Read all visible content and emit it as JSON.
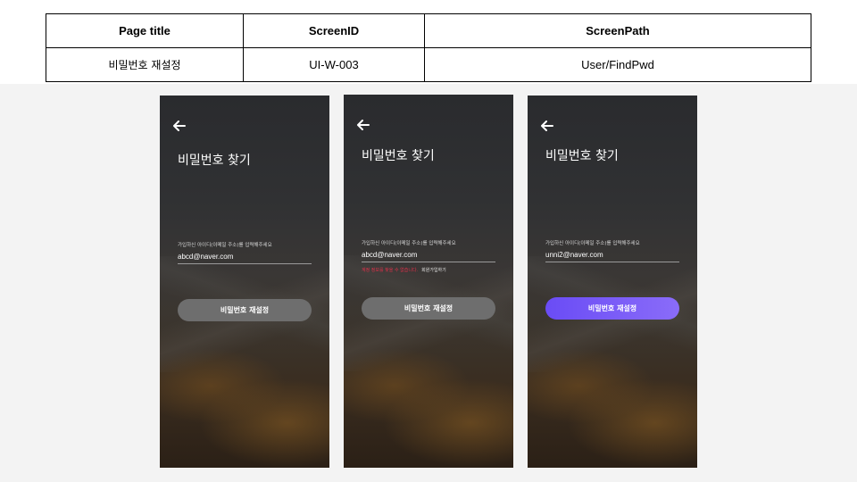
{
  "header": {
    "col1_title": "Page title",
    "col2_title": "ScreenID",
    "col3_title": "ScreenPath",
    "page_title": "비밀번호 재설정",
    "screen_id": "UI-W-003",
    "screen_path": "User/FindPwd"
  },
  "screens": [
    {
      "back_icon": "arrow-left-icon",
      "title": "비밀번호 찾기",
      "email_label": "가입하신 아이디(이메일 주소)를 입력해주세요",
      "email_value": "abcd@naver.com",
      "button_label": "비밀번호 재설정"
    },
    {
      "back_icon": "arrow-left-icon",
      "title": "비밀번호 찾기",
      "email_label": "가입하신 아이디(이메일 주소)를 입력해주세요",
      "email_value": "abcd@naver.com",
      "error_text": "계정 정보를 찾을 수 없습니다.",
      "join_link": "회원가입하기",
      "button_label": "비밀번호 재설정"
    },
    {
      "back_icon": "arrow-left-icon",
      "title": "비밀번호 찾기",
      "email_label": "가입하신 아이디(이메일 주소)를 입력해주세요",
      "email_value": "unni2@naver.com",
      "button_label": "비밀번호 재설정",
      "button_color": "#7b5cf7"
    }
  ]
}
